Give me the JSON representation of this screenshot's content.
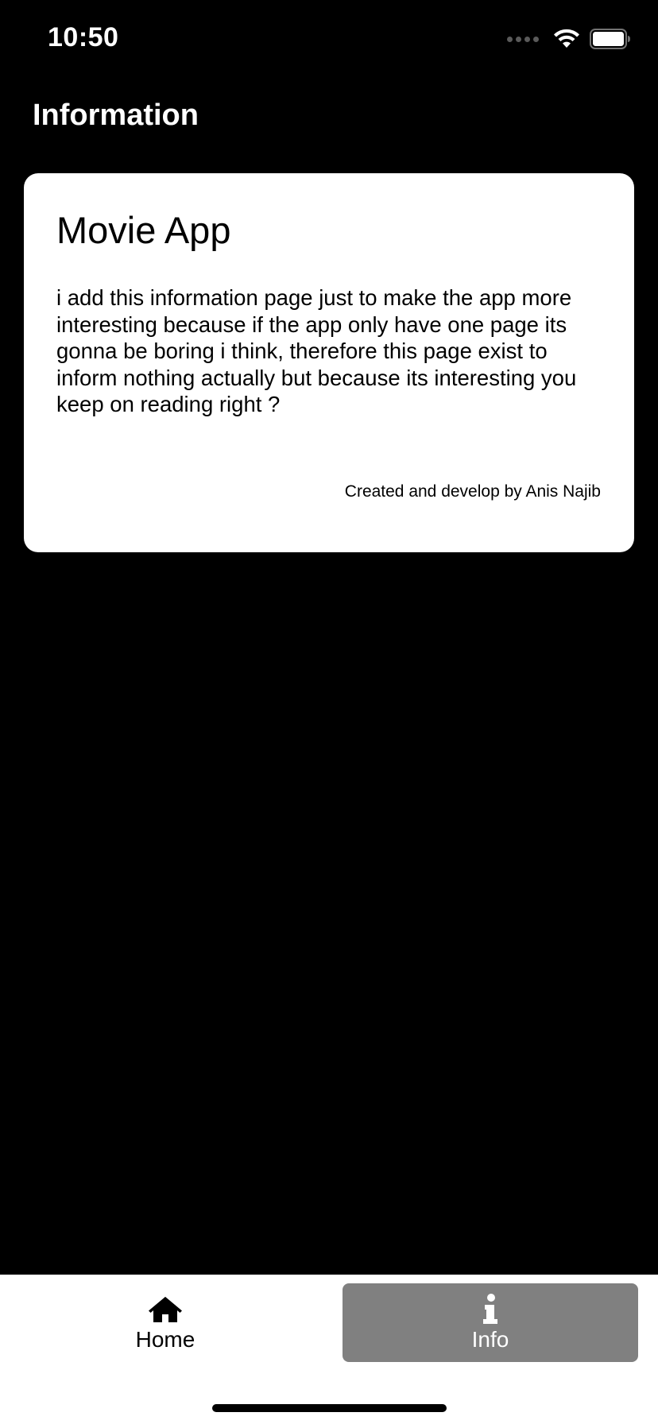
{
  "status_bar": {
    "time": "10:50",
    "icons": [
      "signal-dots-icon",
      "wifi-icon",
      "battery-icon"
    ]
  },
  "header": {
    "title": "Information"
  },
  "card": {
    "title": "Movie App",
    "body": "i add this information page just to make the app more interesting because if the app only have one page its gonna be boring i think, therefore this page exist to inform nothing actually but because its interesting you keep on reading right ?",
    "credit": "Created and develop by Anis Najib"
  },
  "tab_bar": {
    "tabs": [
      {
        "label": "Home",
        "icon": "home-icon",
        "selected": false
      },
      {
        "label": "Info",
        "icon": "info-icon",
        "selected": true
      }
    ]
  },
  "colors": {
    "background": "#000000",
    "card": "#ffffff",
    "tab_selected": "#808080"
  }
}
